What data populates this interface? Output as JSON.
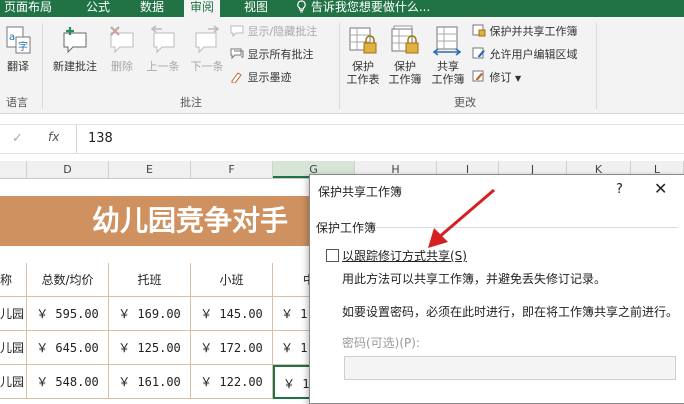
{
  "tabs": [
    {
      "label": "页面布局"
    },
    {
      "label": "公式"
    },
    {
      "label": "数据"
    },
    {
      "label": "审阅",
      "active": true
    },
    {
      "label": "视图"
    }
  ],
  "tell_me": "告诉我您想要做什么...",
  "ribbon": {
    "translate_label": "翻译",
    "group_language": "语言",
    "new_comment": "新建批注",
    "delete": "删除",
    "prev": "上一条",
    "next": "下一条",
    "show_hide_comment": "显示/隐藏批注",
    "show_all_comments": "显示所有批注",
    "show_ink": "显示墨迹",
    "group_comments": "批注",
    "protect_sheet": [
      "保护",
      "工作表"
    ],
    "protect_workbook": [
      "保护",
      "工作簿"
    ],
    "share_workbook": [
      "共享",
      "工作簿"
    ],
    "protect_share": "保护并共享工作簿",
    "allow_edit": "允许用户编辑区域",
    "track_changes": "修订",
    "group_changes": "更改"
  },
  "formula_bar": {
    "value": "138"
  },
  "columns": [
    "D",
    "E",
    "F",
    "G",
    "H",
    "I",
    "J",
    "K",
    "L"
  ],
  "sheet": {
    "banner": "幼儿园竞争对手",
    "headers": [
      "称",
      "总数/均价",
      "托班",
      "小班",
      "中"
    ],
    "rows": [
      [
        "儿园",
        "￥ 595.00",
        "￥ 169.00",
        "￥ 145.00",
        "￥ 1"
      ],
      [
        "儿园",
        "￥ 645.00",
        "￥ 125.00",
        "￥ 172.00",
        "￥ 1"
      ],
      [
        "儿园",
        "￥ 548.00",
        "￥ 161.00",
        "￥ 122.00",
        "￥ 1"
      ]
    ]
  },
  "dialog": {
    "title": "保护共享工作簿",
    "help": "?",
    "section": "保护工作簿",
    "checkbox_label": "以跟踪修订方式共享(S)",
    "checked": false,
    "desc1": "用此方法可以共享工作簿，并避免丢失修订记录。",
    "desc2": "如要设置密码，必须在此时进行，即在将工作簿共享之前进行。",
    "password_label": "密码(可选)(P):",
    "password_value": ""
  },
  "colors": {
    "excel_green": "#217346",
    "banner": "#cf915f",
    "arrow": "#d42020"
  }
}
